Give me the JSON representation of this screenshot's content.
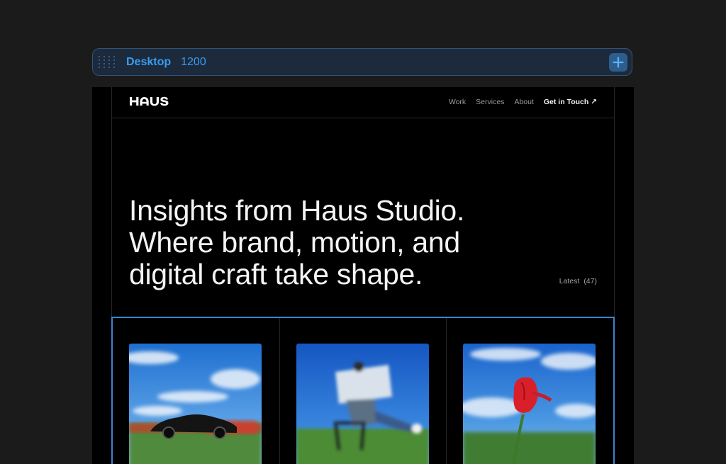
{
  "toolbar": {
    "breakpoint_name": "Desktop",
    "breakpoint_width": "1200",
    "accent": "#3b9cf1",
    "add_icon": "plus-icon",
    "drag_icon": "drag-handle-icon"
  },
  "site": {
    "logo": "HAUS",
    "nav": {
      "items": [
        "Work",
        "Services",
        "About"
      ],
      "cta": "Get in Touch ↗"
    },
    "hero": {
      "lines": [
        "Insights from Haus Studio.",
        "Where brand, motion, and",
        "digital craft take shape."
      ]
    },
    "latest": {
      "label": "Latest",
      "count": "(47)"
    },
    "cards": [
      {
        "image": "blurred sports car on a field"
      },
      {
        "image": "person reading newspaper on a chair"
      },
      {
        "image": "red tulip against blue sky"
      }
    ]
  },
  "colors": {
    "page_bg": "#1b1b1b",
    "canvas_bg": "#000000",
    "selection": "#3a86d0"
  }
}
